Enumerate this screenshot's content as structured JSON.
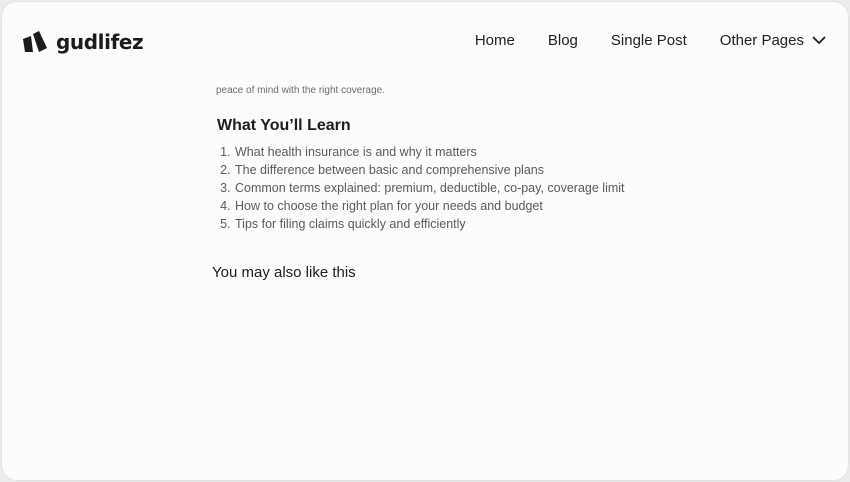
{
  "brand": {
    "name": "gudlifez"
  },
  "nav": {
    "items": [
      "Home",
      "Blog",
      "Single Post"
    ],
    "dropdown_label": "Other Pages"
  },
  "article": {
    "intro_text": "peace of mind with the right coverage.",
    "section_title": "What You’ll Learn",
    "learn_items": [
      "What health insurance is and why it matters",
      "The difference between basic and comprehensive plans",
      "Common terms explained: premium, deductible, co-pay, coverage limit",
      "How to choose the right plan for your needs and budget",
      "Tips for filing claims quickly and efficiently"
    ]
  },
  "related": {
    "title": "You may also like this"
  },
  "icons": {
    "logo": "logo-mark-icon",
    "dropdown": "chevron-down-icon"
  },
  "colors": {
    "text_primary": "#1f1f1f",
    "text_muted": "#5a5a5a",
    "background": "#fcfcfc"
  }
}
